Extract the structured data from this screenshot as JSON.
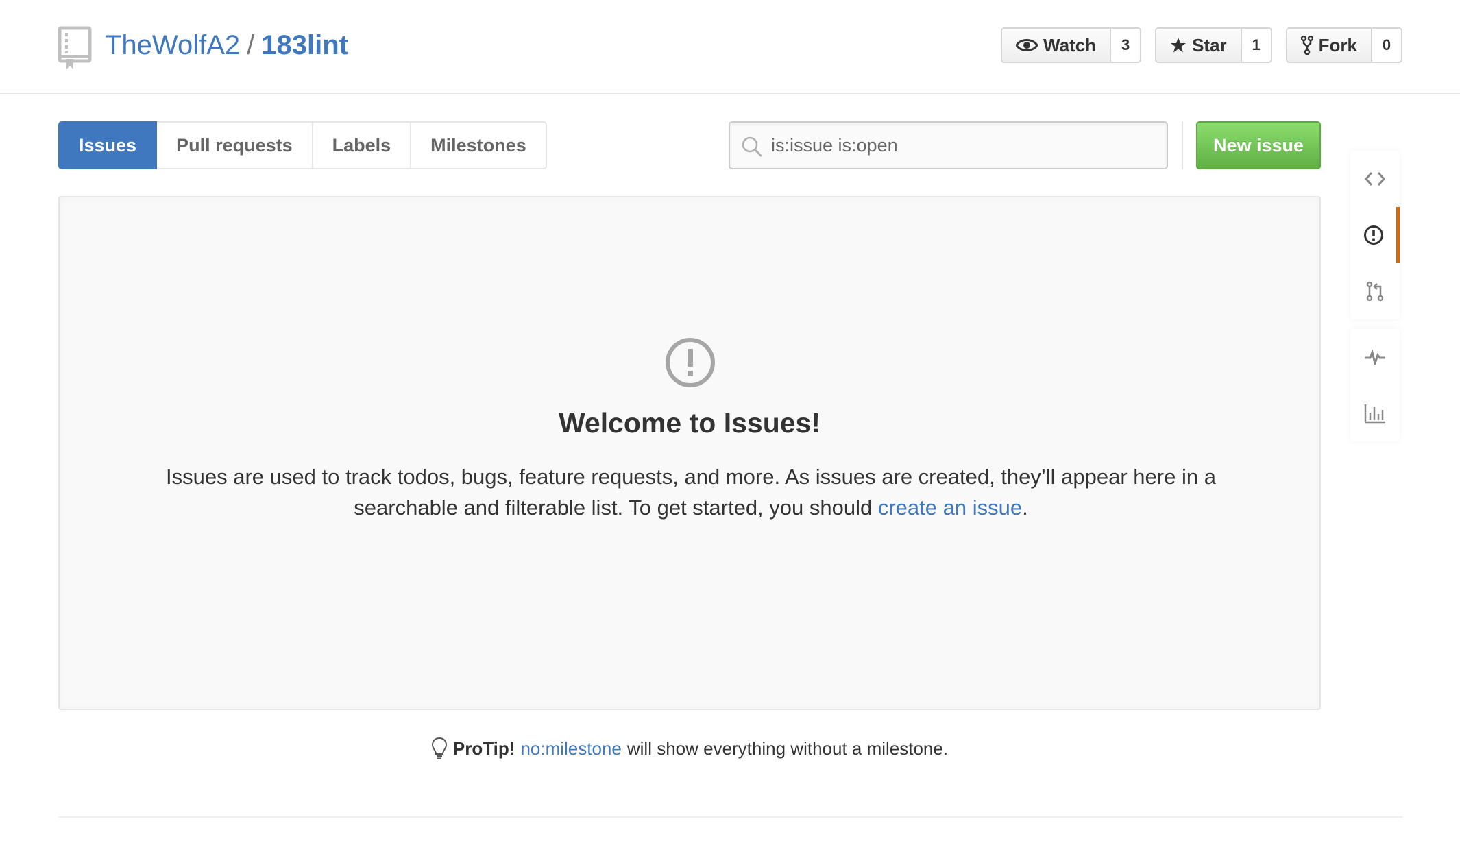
{
  "repo": {
    "owner": "TheWolfA2",
    "separator": "/",
    "name": "183lint"
  },
  "actions": [
    {
      "id": "watch",
      "label": "Watch",
      "count": "3",
      "icon": "eye-icon"
    },
    {
      "id": "star",
      "label": "Star",
      "count": "1",
      "icon": "star-icon"
    },
    {
      "id": "fork",
      "label": "Fork",
      "count": "0",
      "icon": "fork-icon"
    }
  ],
  "subnav": {
    "items": [
      "Issues",
      "Pull requests",
      "Labels",
      "Milestones"
    ],
    "selected": "Issues"
  },
  "search": {
    "value": "",
    "placeholder": "is:issue is:open",
    "icon": "search-icon"
  },
  "new_issue_label": "New issue",
  "blankslate": {
    "icon": "issue-opened-icon",
    "title": "Welcome to Issues!",
    "text_before": "Issues are used to track todos, bugs, feature requests, and more. As issues are created, they’ll appear here in a searchable and filterable list. To get started, you should",
    "link": "create an issue",
    "text_after": "."
  },
  "protip": {
    "icon": "light-bulb-icon",
    "label": "ProTip!",
    "link": "no:milestone",
    "text": "will show everything without a milestone."
  },
  "sidebar": {
    "items": [
      "code-icon",
      "issue-opened-icon",
      "git-pull-request-icon",
      "pulse-icon",
      "graph-icon"
    ],
    "selected": "issue-opened-icon"
  },
  "colors": {
    "link": "#4078c0",
    "selected_tab": "#4078c0",
    "new_issue_green": "#60b044",
    "sidebar_selected": "#d26911"
  }
}
